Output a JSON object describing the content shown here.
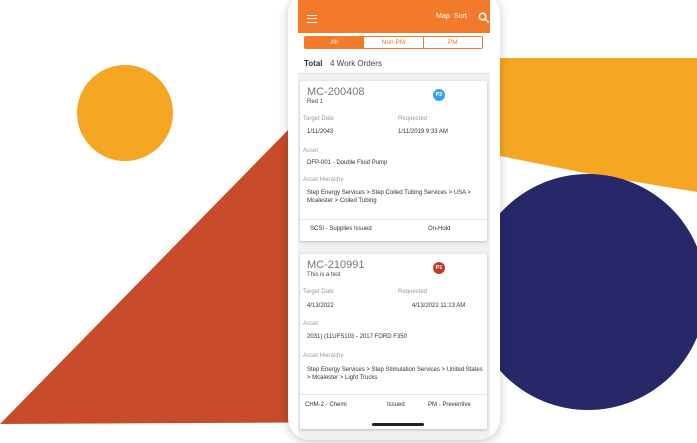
{
  "colors": {
    "accent": "#f47a2b",
    "p2_badge": "#3aa1e5",
    "p1_badge": "#c0392b",
    "deco_red": "#c84b2b",
    "deco_orange": "#f5a623",
    "deco_navy": "#27286a"
  },
  "appbar": {
    "menu_icon": "hamburger-menu-icon",
    "map_label": "Map",
    "sort_label": "Sort",
    "search_icon": "search-icon"
  },
  "filter": {
    "tabs": [
      "All",
      "Non PM",
      "PM"
    ],
    "selected": "All"
  },
  "summary": {
    "total_label": "Total",
    "count_text": "4 Work Orders"
  },
  "work_orders": [
    {
      "number": "MC-200408",
      "description": "Red 1",
      "priority": "P2",
      "target_date_label": "Target Date",
      "target_date": "1/11/2043",
      "requested_label": "Requested",
      "requested": "1/11/2019 9:33 AM",
      "asset_label": "Asset",
      "asset": "DFP-001 - Double Fluid Pump",
      "hierarchy_label": "Asset Hierachy",
      "hierarchy": "Step Energy Services > Step Coiled Tubing Services > USA > Mcalester > Coiled Tubing",
      "footer": [
        "SCSI - Supplies Issued",
        "On-Hold"
      ]
    },
    {
      "number": "MC-210991",
      "description": "This is a test",
      "priority": "P1",
      "target_date_label": "Target Date",
      "target_date": "4/13/2022",
      "requested_label": "Requested",
      "requested": "4/13/2022 11:13 AM",
      "asset_label": "Asset",
      "asset": "2031) (11UFS103 - 2017 FORD F350",
      "hierarchy_label": "Asset Hierachy",
      "hierarchy": "Step Energy Services > Step Stimulation Services > United States > Mcalester > Light Trucks",
      "footer": [
        "CHM-2 - Chemi",
        "Issued",
        "PM - Preventive"
      ]
    }
  ]
}
